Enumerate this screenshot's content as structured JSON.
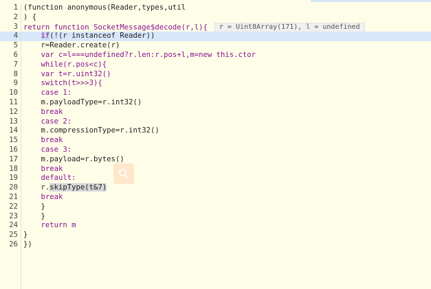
{
  "editor": {
    "line_numbers": [
      "1",
      "2",
      "3",
      "4",
      "5",
      "6",
      "7",
      "8",
      "9",
      "10",
      "11",
      "12",
      "13",
      "14",
      "15",
      "16",
      "17",
      "18",
      "19",
      "20",
      "21",
      "22",
      "23",
      "24",
      "25",
      "26"
    ],
    "current_line": 4,
    "inline_value": "r = Uint8Array(171), l = undefined",
    "lines": {
      "l1": "(function anonymous(Reader,types,util",
      "l2": ") {",
      "l3": "return function SocketMessage$decode(r,l){",
      "l4a": "if",
      "l4b": "(!(r instanceof Reader))",
      "l5": "r=Reader.create(r)",
      "l6": "var c=l===undefined?r.len:r.pos+l,m=new this.ctor",
      "l7": "while(r.pos<c){",
      "l8": "var t=r.uint32()",
      "l9": "switch(t>>>3){",
      "l10": "case 1:",
      "l11": "m.payloadType=r.int32()",
      "l12": "break",
      "l13": "case 2:",
      "l14": "m.compressionType=r.int32()",
      "l15": "break",
      "l16": "case 3:",
      "l17": "m.payload=r.bytes()",
      "l18": "break",
      "l19": "default:",
      "l20a": "r.",
      "l20b": "skipType(t&7)",
      "l21": "break",
      "l22": "}",
      "l23": "}",
      "l24": "return m",
      "l25": "}",
      "l26": "})"
    }
  },
  "overlay": {
    "icon": "search-icon"
  }
}
